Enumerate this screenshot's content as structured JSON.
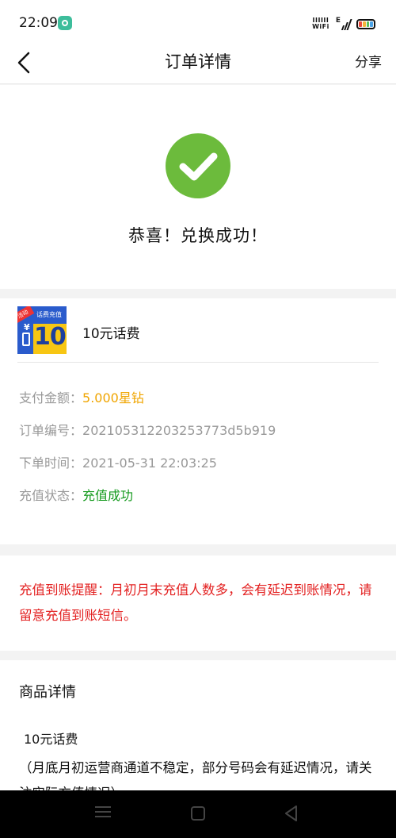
{
  "status_bar": {
    "time": "22:09",
    "network_label": "WiFi",
    "network_bars": "IIIIII",
    "signal_type": "E",
    "battery_colors": [
      "#e84a3c",
      "#f5b53c",
      "#5ac05a",
      "#4aa3e8"
    ]
  },
  "nav": {
    "title": "订单详情",
    "share_label": "分享"
  },
  "success": {
    "message": "恭喜！兑换成功！",
    "icon_color": "#6cbb3c"
  },
  "order": {
    "product": {
      "name": "10元话费",
      "thumb_tag": "活动",
      "thumb_label": "话费充值",
      "thumb_value": "10",
      "thumb_currency": "¥"
    },
    "rows": [
      {
        "label": "支付金额：",
        "value": "5.000星钻"
      },
      {
        "label": "订单编号：",
        "value": "20210531220325377 3d5b919"
      },
      {
        "label": "下单时间：",
        "value": "2021-05-31 22:03:25"
      },
      {
        "label": "充值状态：",
        "value": "充值成功"
      }
    ],
    "amount_color": "#f0a500",
    "status_color": "#159a1e"
  },
  "notice": {
    "text": "充值到账提醒：月初月末充值人数多，会有延迟到账情况，请留意充值到账短信。",
    "color": "#e32222"
  },
  "detail": {
    "title": "商品详情",
    "name": "10元话费",
    "description": "（月底月初运营商通道不稳定，部分号码会有延迟情况，请关注实际充值情况）"
  }
}
